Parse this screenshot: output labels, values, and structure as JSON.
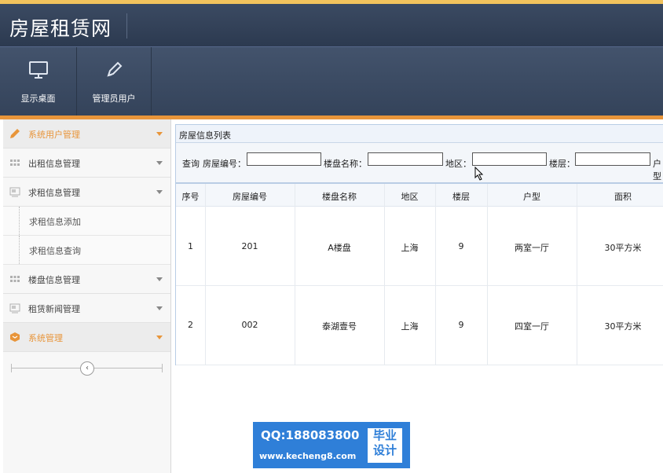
{
  "header": {
    "title": "房屋租赁网"
  },
  "toolbar": {
    "items": [
      {
        "label": "显示桌面",
        "icon": "monitor-icon"
      },
      {
        "label": "管理员用户",
        "icon": "pencil-icon"
      }
    ]
  },
  "sidebar": {
    "items": [
      {
        "label": "系统用户管理",
        "icon": "pencil-icon",
        "active": true
      },
      {
        "label": "出租信息管理",
        "icon": "grid-icon"
      },
      {
        "label": "求租信息管理",
        "icon": "window-icon"
      },
      {
        "label": "楼盘信息管理",
        "icon": "grid-icon"
      },
      {
        "label": "租赁新闻管理",
        "icon": "window-icon"
      },
      {
        "label": "系统管理",
        "icon": "box-icon",
        "active": true
      }
    ],
    "subitems": [
      {
        "label": "求租信息添加"
      },
      {
        "label": "求租信息查询"
      }
    ],
    "collapse_icon": "‹"
  },
  "panel": {
    "title": "房屋信息列表",
    "search": {
      "query_label": "查询",
      "fields": [
        {
          "label": "房屋编号：",
          "value": ""
        },
        {
          "label": "楼盘名称：",
          "value": ""
        },
        {
          "label": "地区：",
          "value": ""
        },
        {
          "label": "楼层：",
          "value": ""
        },
        {
          "label": "户型",
          "value": ""
        }
      ]
    },
    "table": {
      "columns": [
        "序号",
        "房屋编号",
        "楼盘名称",
        "地区",
        "楼层",
        "户型",
        "面积"
      ],
      "rows": [
        [
          "1",
          "201",
          "A楼盘",
          "上海",
          "9",
          "两室一厅",
          "30平方米"
        ],
        [
          "2",
          "002",
          "泰湖壹号",
          "上海",
          "9",
          "四室一厅",
          "30平方米"
        ]
      ]
    }
  },
  "watermark": {
    "qq": "QQ:188083800",
    "url": "www.kecheng8.com",
    "badge_line1": "毕业",
    "badge_line2": "设计"
  },
  "colors": {
    "header_bg": "#2c3a50",
    "accent_orange": "#e8953a",
    "panel_border": "#b9cde5",
    "watermark_blue": "#2f7fd8"
  }
}
